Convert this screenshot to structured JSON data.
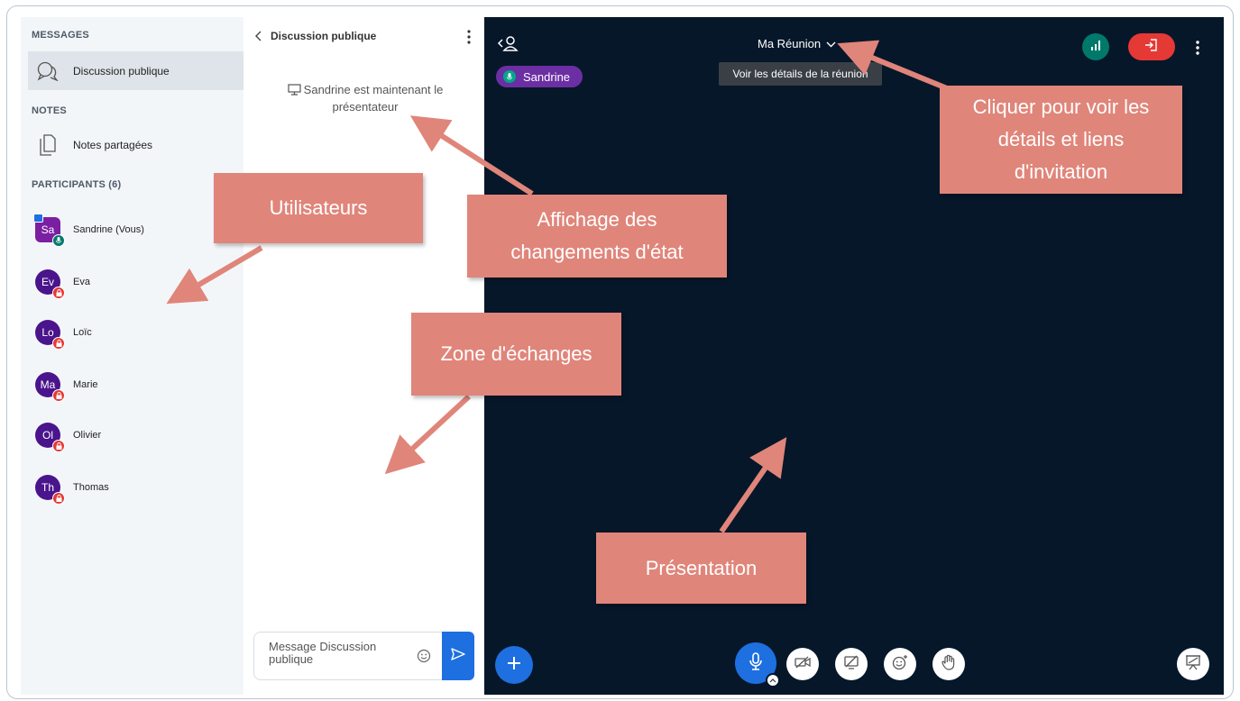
{
  "sidebar": {
    "messages_title": "MESSAGES",
    "public_chat_label": "Discussion publique",
    "notes_title": "NOTES",
    "shared_notes_label": "Notes partagées",
    "participants_title": "PARTICIPANTS (6)",
    "users": [
      {
        "initials": "Sa",
        "name": "Sandrine (Vous)"
      },
      {
        "initials": "Ev",
        "name": "Eva"
      },
      {
        "initials": "Lo",
        "name": "Loïc"
      },
      {
        "initials": "Ma",
        "name": "Marie"
      },
      {
        "initials": "Ol",
        "name": "Olivier"
      },
      {
        "initials": "Th",
        "name": "Thomas"
      }
    ]
  },
  "chat": {
    "title": "Discussion publique",
    "status_message": "Sandrine est maintenant le présentateur",
    "input_placeholder": "Message Discussion publique"
  },
  "main": {
    "meeting_title": "Ma Réunion",
    "tooltip": "Voir les détails de la réunion",
    "presenter_name": "Sandrine"
  },
  "annotations": {
    "users": "Utilisateurs",
    "state_changes": "Affichage des changements d'état",
    "exchange_zone": "Zone d'échanges",
    "meeting_details": "Cliquer pour voir les détails et liens d'invitation",
    "presentation": "Présentation"
  },
  "colors": {
    "annotation": "#e0857a",
    "main_bg": "#06172a",
    "accent_blue": "#1e6fe0",
    "leave_red": "#e53935",
    "connection_green": "#00796b",
    "presenter_purple": "#6b2fa3"
  },
  "icons": [
    "chat-bubbles-icon",
    "notes-icon",
    "chevron-left-icon",
    "kebab-menu-icon",
    "presentation-icon",
    "emoji-icon",
    "send-icon",
    "collapse-user-list-icon",
    "chevron-down-icon",
    "microphone-icon",
    "signal-icon",
    "leave-icon",
    "plus-icon",
    "camera-off-icon",
    "screen-share-off-icon",
    "reaction-icon",
    "raise-hand-icon"
  ]
}
